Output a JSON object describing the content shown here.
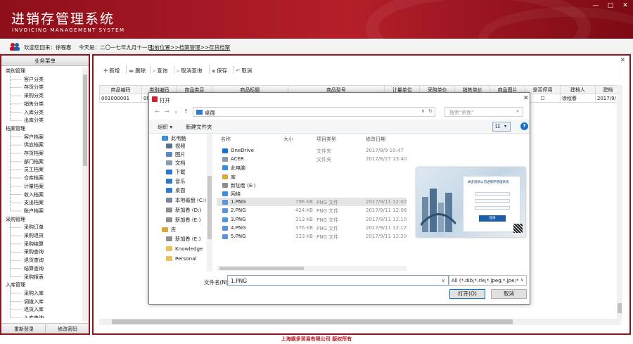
{
  "app": {
    "title": "进销存管理系统",
    "subtitle": "INVOICING MANAGEMENT SYSTEM",
    "win_min": "—",
    "win_max": "□",
    "win_close": "✕"
  },
  "info": {
    "welcome": "欢迎您回来：徐程春",
    "today": "今天是：二〇一七年九月十一日",
    "location": "当前位置>>档案管理>>存货档案"
  },
  "sidebar": {
    "header": "业务菜单",
    "tree": [
      {
        "label": "类别管理",
        "level": 0
      },
      {
        "label": "客户分类",
        "level": 1
      },
      {
        "label": "存货分类",
        "level": 1
      },
      {
        "label": "采购分类",
        "level": 1
      },
      {
        "label": "销售分类",
        "level": 1
      },
      {
        "label": "入库分类",
        "level": 1
      },
      {
        "label": "出库分类",
        "level": 1
      },
      {
        "label": "档案管理",
        "level": 0
      },
      {
        "label": "客户档案",
        "level": 1
      },
      {
        "label": "供应档案",
        "level": 1
      },
      {
        "label": "存货档案",
        "level": 1
      },
      {
        "label": "部门档案",
        "level": 1
      },
      {
        "label": "员工档案",
        "level": 1
      },
      {
        "label": "仓库档案",
        "level": 1
      },
      {
        "label": "计量档案",
        "level": 1
      },
      {
        "label": "收入档案",
        "level": 1
      },
      {
        "label": "支出档案",
        "level": 1
      },
      {
        "label": "账户档案",
        "level": 1
      },
      {
        "label": "采购管理",
        "level": 0
      },
      {
        "label": "采购订单",
        "level": 1
      },
      {
        "label": "采购退货",
        "level": 1
      },
      {
        "label": "采购结算",
        "level": 1
      },
      {
        "label": "采购查询",
        "level": 1
      },
      {
        "label": "退货查询",
        "level": 1
      },
      {
        "label": "结算查询",
        "level": 1
      },
      {
        "label": "采购报表",
        "level": 1
      },
      {
        "label": "入库管理",
        "level": 0
      },
      {
        "label": "采购入库",
        "level": 1
      },
      {
        "label": "调拨入库",
        "level": 1
      },
      {
        "label": "退货入库",
        "level": 1
      },
      {
        "label": "入库查询",
        "level": 1
      }
    ],
    "relogin": "重新登录",
    "change_password": "修改密码"
  },
  "toolbar": {
    "new": "新增",
    "delete": "删除",
    "query": "查询",
    "cancel_query": "取消查询",
    "save": "保存",
    "cancel": "取消"
  },
  "grid": {
    "columns": [
      "商品编码",
      "类别编码",
      "商品类目",
      "商品标题",
      "商品型号",
      "计量单位",
      "采购单价",
      "销售单价",
      "商品图片",
      "是否停用",
      "建档人",
      "建档"
    ],
    "rows": [
      [
        "001000001",
        "001",
        "",
        "",
        "",
        "",
        "",
        "",
        "",
        "☐",
        "徐程春",
        "2017/9/"
      ]
    ]
  },
  "dialog": {
    "title": "打开",
    "close": "✕",
    "path": "桌面",
    "search_placeholder": "搜索\"桌面\"",
    "organize": "组织 ▾",
    "new_folder": "新建文件夹",
    "help": "?",
    "nav_items": [
      {
        "label": "此电脑",
        "icon": "computer-icon",
        "color": "#3c8ddc"
      },
      {
        "label": "视频",
        "icon": "video-folder-icon",
        "color": "#5a6f8a"
      },
      {
        "label": "图片",
        "icon": "pictures-folder-icon",
        "color": "#5a8ac0"
      },
      {
        "label": "文档",
        "icon": "documents-folder-icon",
        "color": "#8a9bb0"
      },
      {
        "label": "下载",
        "icon": "download-folder-icon",
        "color": "#2a78d0"
      },
      {
        "label": "音乐",
        "icon": "music-folder-icon",
        "color": "#2a78d0"
      },
      {
        "label": "桌面",
        "icon": "desktop-folder-icon",
        "color": "#2f7bd1"
      },
      {
        "label": "本地磁盘 (C:)",
        "icon": "drive-c-icon",
        "color": "#7a8896"
      },
      {
        "label": "新加卷 (D:)",
        "icon": "drive-d-icon",
        "color": "#8a8f96"
      },
      {
        "label": "新加卷 (E:)",
        "icon": "drive-e-icon",
        "color": "#8a8f96"
      },
      {
        "label": "库",
        "icon": "library-icon",
        "color": "#d9a93a"
      },
      {
        "label": "新加卷 (E:)",
        "icon": "drive-e-icon",
        "color": "#8a8f96"
      },
      {
        "label": "Knowledge",
        "icon": "folder-icon",
        "color": "#e8c15a"
      },
      {
        "label": "Personal",
        "icon": "folder-icon",
        "color": "#e8c15a"
      }
    ],
    "file_headers": {
      "name": "名称",
      "size": "大小",
      "type": "项目类型",
      "date": "修改日期"
    },
    "files": [
      {
        "name": "OneDrive",
        "size": "",
        "type": "文件夹",
        "date": "2017/9/9 10:47",
        "icon": "onedrive-icon",
        "color": "#1d6fd1"
      },
      {
        "name": "ACER",
        "size": "",
        "type": "文件夹",
        "date": "2017/8/27 13:40",
        "icon": "user-folder-icon",
        "color": "#8a9bb0"
      },
      {
        "name": "此电脑",
        "size": "",
        "type": "",
        "date": "",
        "icon": "computer-icon",
        "color": "#3c8ddc"
      },
      {
        "name": "库",
        "size": "",
        "type": "",
        "date": "",
        "icon": "library-icon",
        "color": "#d9a93a"
      },
      {
        "name": "新加卷 (E:)",
        "size": "",
        "type": "",
        "date": "",
        "icon": "drive-icon",
        "color": "#8a8f96"
      },
      {
        "name": "网络",
        "size": "",
        "type": "",
        "date": "",
        "icon": "network-icon",
        "color": "#3c8ddc"
      },
      {
        "name": "1.PNG",
        "size": "796 KB",
        "type": "PNG 文件",
        "date": "2017/9/11 12:02",
        "icon": "png-file-icon",
        "color": "#5a95d8",
        "selected": true
      },
      {
        "name": "2.PNG",
        "size": "424 KB",
        "type": "PNG 文件",
        "date": "2017/9/11 12:08",
        "icon": "png-file-icon",
        "color": "#5a95d8"
      },
      {
        "name": "3.PNG",
        "size": "313 KB",
        "type": "PNG 文件",
        "date": "2017/9/11 12:10",
        "icon": "png-file-icon",
        "color": "#5a95d8"
      },
      {
        "name": "4.PNG",
        "size": "376 KB",
        "type": "PNG 文件",
        "date": "2017/9/11 12:12",
        "icon": "png-file-icon",
        "color": "#5a95d8"
      },
      {
        "name": "5.PNG",
        "size": "333 KB",
        "type": "PNG 文件",
        "date": "2017/9/11 12:20",
        "icon": "png-file-icon",
        "color": "#5a95d8"
      }
    ],
    "preview_title": "飒多贸易公司进销存管理系统",
    "preview_login": "登录",
    "filename_label": "文件名(N):",
    "filename_value": "1.PNG",
    "filetype_value": "All (*.dib;*.rle;*.jpeg;*.jpe;*.jp",
    "open_button": "打开(O)",
    "cancel_button": "取消"
  },
  "footer": {
    "text": "上海飒多贸易有限公司    版权所有"
  },
  "colors": {
    "brand": "#8e1420",
    "accent": "#0078d7"
  }
}
